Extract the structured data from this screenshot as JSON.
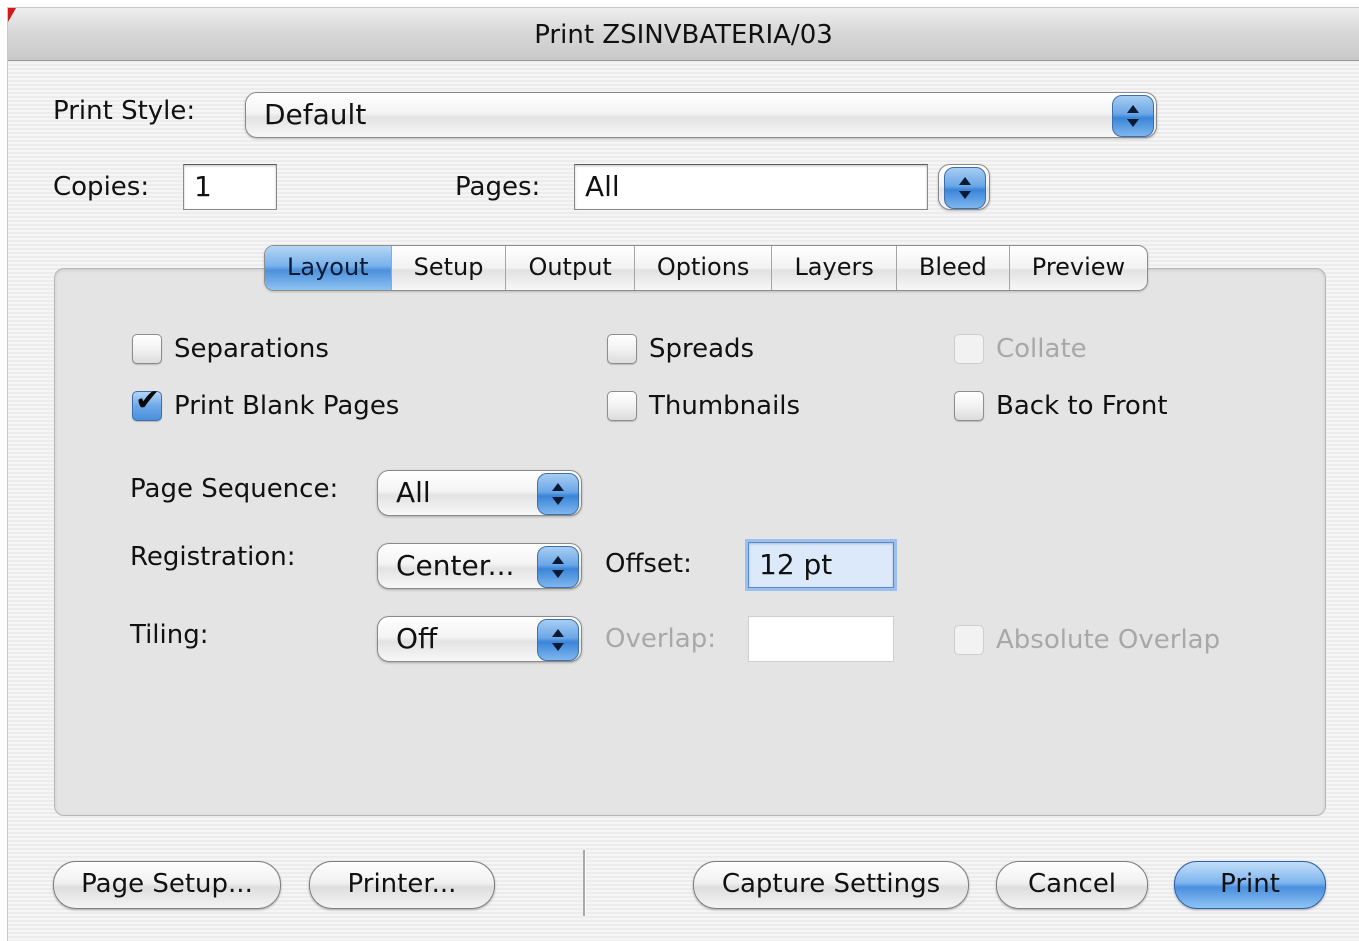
{
  "window": {
    "title": "Print ZSINVBATERIA/03"
  },
  "print_style": {
    "label": "Print Style:",
    "value": "Default"
  },
  "copies": {
    "label": "Copies:",
    "value": "1"
  },
  "pages": {
    "label": "Pages:",
    "value": "All"
  },
  "tabs": [
    {
      "label": "Layout",
      "active": true
    },
    {
      "label": "Setup"
    },
    {
      "label": "Output"
    },
    {
      "label": "Options"
    },
    {
      "label": "Layers"
    },
    {
      "label": "Bleed"
    },
    {
      "label": "Preview"
    }
  ],
  "layout": {
    "separations": {
      "label": "Separations",
      "checked": false
    },
    "spreads": {
      "label": "Spreads",
      "checked": false
    },
    "collate": {
      "label": "Collate",
      "checked": false,
      "enabled": false
    },
    "print_blank_pages": {
      "label": "Print Blank Pages",
      "checked": true
    },
    "thumbnails": {
      "label": "Thumbnails",
      "checked": false
    },
    "back_to_front": {
      "label": "Back to Front",
      "checked": false
    },
    "page_sequence": {
      "label": "Page Sequence:",
      "value": "All"
    },
    "registration": {
      "label": "Registration:",
      "value": "Center..."
    },
    "offset": {
      "label": "Offset:",
      "value": "12 pt"
    },
    "tiling": {
      "label": "Tiling:",
      "value": "Off"
    },
    "overlap": {
      "label": "Overlap:",
      "value": "",
      "enabled": false
    },
    "absolute_overlap": {
      "label": "Absolute Overlap",
      "checked": false,
      "enabled": false
    }
  },
  "buttons": {
    "page_setup": "Page Setup...",
    "printer": "Printer...",
    "capture_settings": "Capture Settings",
    "cancel": "Cancel",
    "print": "Print"
  },
  "colors": {
    "accent_blue": "#4b90dc",
    "disabled_text": "#a8a8a8",
    "corner_red": "#d21a1a"
  }
}
